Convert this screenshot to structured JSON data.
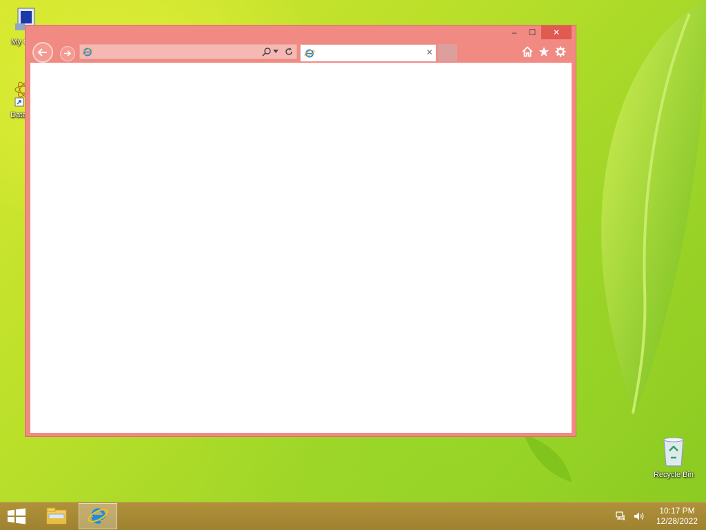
{
  "desktop": {
    "icons": [
      {
        "label": "My Co",
        "icon": "computer-icon"
      },
      {
        "label": "DataW",
        "icon": "datawave-shortcut-icon"
      },
      {
        "label": "Recycle Bin",
        "icon": "recycle-bin-icon"
      }
    ]
  },
  "browser": {
    "window_controls": {
      "minimize": "–",
      "maximize": "☐",
      "close": "✕"
    },
    "address": {
      "value": "",
      "placeholder": ""
    },
    "tab": {
      "title": "",
      "close": "✕"
    },
    "colors": {
      "frame": "#f08a82",
      "close_button": "#e05a50"
    }
  },
  "taskbar": {
    "apps": [
      {
        "name": "File Explorer",
        "icon": "file-explorer-icon"
      },
      {
        "name": "Internet Explorer",
        "icon": "internet-explorer-icon",
        "active": true
      }
    ],
    "clock": {
      "time": "10:17 PM",
      "date": "12/28/2022"
    }
  }
}
